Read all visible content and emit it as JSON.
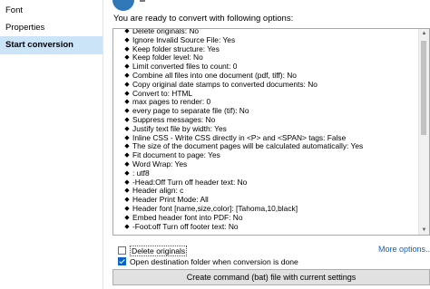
{
  "sidebar": {
    "items": [
      {
        "label": "Font",
        "active": false
      },
      {
        "label": "Properties",
        "active": false
      },
      {
        "label": "Start conversion",
        "active": true
      }
    ]
  },
  "main": {
    "intro_text": "You are ready to convert with following options:",
    "options": [
      "Delete originals: No",
      "Ignore Invalid Source File: Yes",
      "Keep folder structure: Yes",
      "Keep folder level: No",
      "Limit converted files to count: 0",
      "Combine all files into one document (pdf, tiff): No",
      "Copy original date stamps to converted documents: No",
      "Convert to: HTML",
      "max pages to render: 0",
      "every page to separate file (tif): No",
      "Suppress messages: No",
      "Justify text file by width: Yes",
      "Inline CSS - Write CSS directly in <P> and <SPAN> tags: False",
      "The size of the document pages will be calculated automatically: Yes",
      "Fit document to page: Yes",
      "Word Wrap: Yes",
      ": utf8",
      "-Head:Off Turn off header text: No",
      "Header align: c",
      "Header Print Mode: All",
      "Header font [name,size,color]: [Tahoma,10,black]",
      "Embed header font into PDF: No",
      "-Foot:off Turn off footer text: No"
    ],
    "delete_originals": {
      "label": "Delete originals",
      "checked": false
    },
    "open_destination": {
      "label": "Open destination folder when conversion is done",
      "checked": true
    },
    "more_options_label": "More options..",
    "create_button_label": "Create command (bat) file with current settings"
  },
  "colors": {
    "accent": "#0b62c4",
    "sidebar_active": "#cce4f7",
    "logo": "#2f78b7"
  }
}
